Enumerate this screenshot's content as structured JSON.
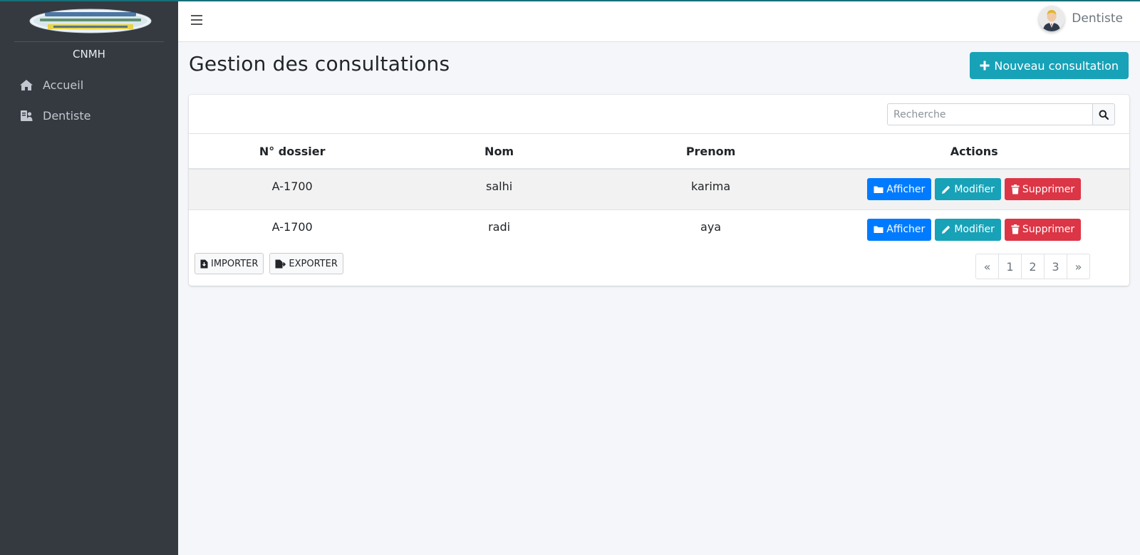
{
  "app": {
    "brand": "CNMH",
    "logo_text": {
      "arabic": "المركز الوطني محمد السادس للمعاقين",
      "french": "Centre National Mohammed VI Des Handicapés",
      "section": "SECTION REGIONALE DE TANGER"
    }
  },
  "sidebar": {
    "items": [
      {
        "label": "Accueil",
        "icon": "home-icon"
      },
      {
        "label": "Dentiste",
        "icon": "user-id-icon"
      }
    ]
  },
  "header": {
    "user_name": "Dentiste"
  },
  "page": {
    "title": "Gestion des consultations",
    "new_button": "Nouveau consultation"
  },
  "search": {
    "placeholder": "Recherche"
  },
  "table": {
    "columns": [
      "N° dossier",
      "Nom",
      "Prenom",
      "Actions"
    ],
    "rows": [
      {
        "dossier": "A-1700",
        "nom": "salhi",
        "prenom": "karima"
      },
      {
        "dossier": "A-1700",
        "nom": "radi",
        "prenom": "aya"
      }
    ],
    "actions": {
      "view": "Afficher",
      "edit": "Modifier",
      "delete": "Supprimer"
    }
  },
  "footer": {
    "import_label": "IMPORTER",
    "export_label": "EXPORTER"
  },
  "pagination": {
    "prev": "«",
    "pages": [
      "1",
      "2",
      "3"
    ],
    "next": "»"
  },
  "colors": {
    "sidebar_bg": "#343a40",
    "accent_teal": "#17a2b8",
    "primary_blue": "#007bff",
    "danger_red": "#dc3545"
  }
}
